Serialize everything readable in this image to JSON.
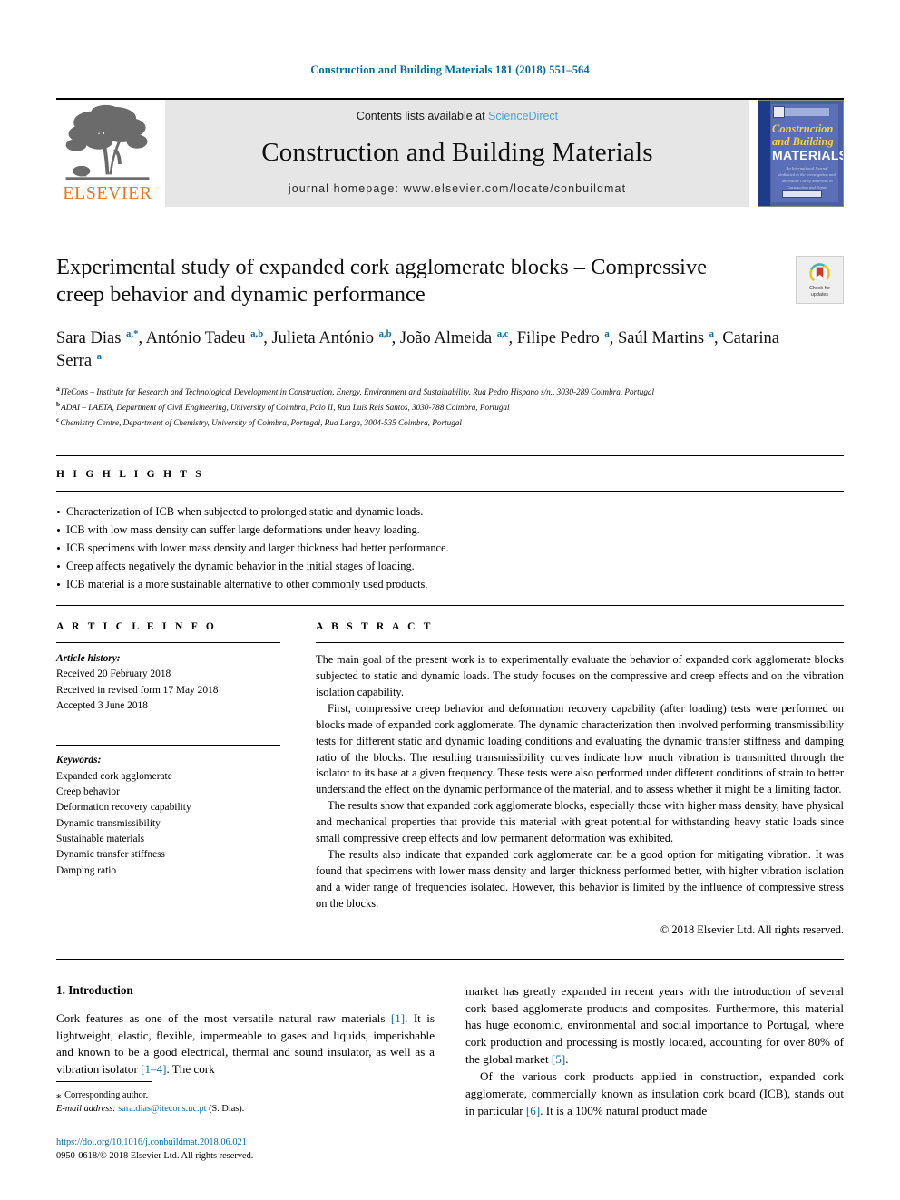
{
  "running_head": "Construction and Building Materials 181 (2018) 551–564",
  "masthead": {
    "publisher_name": "ELSEVIER",
    "contents_prefix": "Contents lists available at ",
    "contents_link": "ScienceDirect",
    "journal_title": "Construction and Building Materials",
    "homepage": "journal homepage: www.elsevier.com/locate/conbuildmat",
    "cover": {
      "line1": "Construction",
      "line2": "and Building",
      "line3": "MATERIALS",
      "blurb": "An International Journal dedicated to the Investigation and Innovative Use of Materials in Construction and Repair"
    }
  },
  "article": {
    "title": "Experimental study of expanded cork agglomerate blocks – Compressive creep behavior and dynamic performance",
    "crossmark_label_line1": "Check for",
    "crossmark_label_line2": "updates",
    "authors_html": "Sara Dias <sup>a,*</sup>, António Tadeu <sup>a,b</sup>, Julieta António <sup>a,b</sup>, João Almeida <sup>a,c</sup>, Filipe Pedro <sup>a</sup>, Saúl Martins <sup>a</sup>, Catarina Serra <sup>a</sup>",
    "affiliations": [
      {
        "mark": "a",
        "text": "ITeCons – Institute for Research and Technological Development in Construction, Energy, Environment and Sustainability, Rua Pedro Hispano s/n., 3030-289 Coimbra, Portugal"
      },
      {
        "mark": "b",
        "text": "ADAI – LAETA, Department of Civil Engineering, University of Coimbra, Pólo II, Rua Luís Reis Santos, 3030-788 Coimbra, Portugal"
      },
      {
        "mark": "c",
        "text": "Chemistry Centre, Department of Chemistry, University of Coimbra, Portugal, Rua Larga, 3004-535 Coimbra, Portugal"
      }
    ]
  },
  "highlights": {
    "heading": "H I G H L I G H T S",
    "items": [
      "Characterization of ICB when subjected to prolonged static and dynamic loads.",
      "ICB with low mass density can suffer large deformations under heavy loading.",
      "ICB specimens with lower mass density and larger thickness had better performance.",
      "Creep affects negatively the dynamic behavior in the initial stages of loading.",
      "ICB material is a more sustainable alternative to other commonly used products."
    ]
  },
  "article_info": {
    "heading": "A R T I C L E   I N F O",
    "history_label": "Article history:",
    "history": [
      "Received 20 February 2018",
      "Received in revised form 17 May 2018",
      "Accepted 3 June 2018"
    ],
    "keywords_label": "Keywords:",
    "keywords": [
      "Expanded cork agglomerate",
      "Creep behavior",
      "Deformation recovery capability",
      "Dynamic transmissibility",
      "Sustainable materials",
      "Dynamic transfer stiffness",
      "Damping ratio"
    ]
  },
  "abstract": {
    "heading": "A B S T R A C T",
    "paragraphs": [
      "The main goal of the present work is to experimentally evaluate the behavior of expanded cork agglomerate blocks subjected to static and dynamic loads. The study focuses on the compressive and creep effects and on the vibration isolation capability.",
      "First, compressive creep behavior and deformation recovery capability (after loading) tests were performed on blocks made of expanded cork agglomerate. The dynamic characterization then involved performing transmissibility tests for different static and dynamic loading conditions and evaluating the dynamic transfer stiffness and damping ratio of the blocks. The resulting transmissibility curves indicate how much vibration is transmitted through the isolator to its base at a given frequency. These tests were also performed under different conditions of strain to better understand the effect on the dynamic performance of the material, and to assess whether it might be a limiting factor.",
      "The results show that expanded cork agglomerate blocks, especially those with higher mass density, have physical and mechanical properties that provide this material with great potential for withstanding heavy static loads since small compressive creep effects and low permanent deformation was exhibited.",
      "The results also indicate that expanded cork agglomerate can be a good option for mitigating vibration. It was found that specimens with lower mass density and larger thickness performed better, with higher vibration isolation and a wider range of frequencies isolated. However, this behavior is limited by the influence of compressive stress on the blocks."
    ],
    "copyright": "© 2018 Elsevier Ltd. All rights reserved."
  },
  "body": {
    "section_heading": "1. Introduction",
    "left_paragraph_html": "Cork features as one of the most versatile natural raw materials <span class=\"ref\">[1]</span>. It is lightweight, elastic, flexible, impermeable to gases and liquids, imperishable and known to be a good electrical, thermal and sound insulator, as well as a vibration isolator <span class=\"ref\">[1–4]</span>. The cork",
    "right_paragraph_1_html": "market has greatly expanded in recent years with the introduction of several cork based agglomerate products and composites. Furthermore, this material has huge economic, environmental and social importance to Portugal, where cork production and processing is mostly located, accounting for over 80% of the global market <span class=\"ref\">[5]</span>.",
    "right_paragraph_2_html": "Of the various cork products applied in construction, expanded cork agglomerate, commercially known as insulation cork board (ICB), stands out in particular <span class=\"ref\">[6]</span>. It is a 100% natural product made"
  },
  "footnotes": {
    "corresponding_marker": "⁎",
    "corresponding_text": "Corresponding author.",
    "email_label": "E-mail address:",
    "email": "sara.dias@itecons.uc.pt",
    "email_suffix": "(S. Dias).",
    "doi": "https://doi.org/10.1016/j.conbuildmat.2018.06.021",
    "issn_line": "0950-0618/© 2018 Elsevier Ltd. All rights reserved."
  },
  "colors": {
    "link": "#0b6ba0",
    "sciencedirect": "#4aa3d8",
    "elsevier_orange": "#e87722",
    "masthead_bg": "#e6e6e6"
  }
}
